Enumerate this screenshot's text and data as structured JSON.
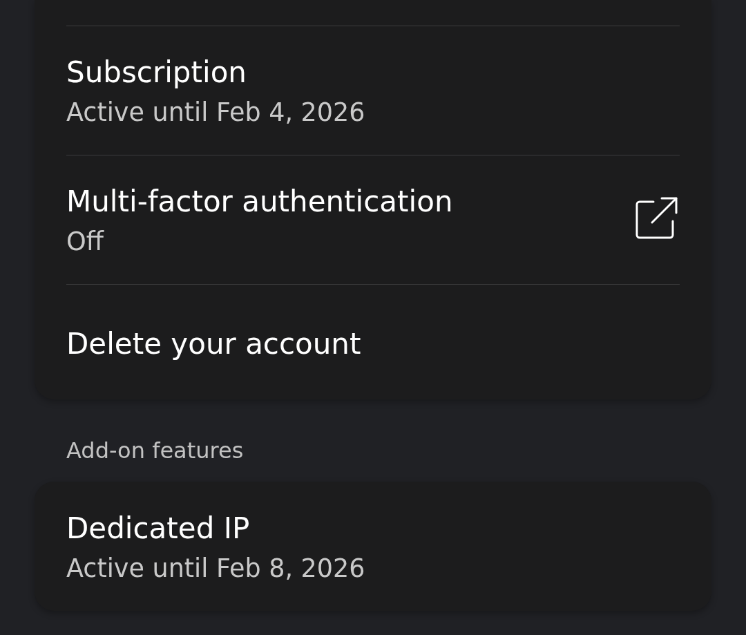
{
  "account_card": {
    "items": [
      {
        "kind": "status",
        "title": "Subscription",
        "subtitle": "Active until Feb 4, 2026"
      },
      {
        "kind": "external_link",
        "title": "Multi-factor authentication",
        "subtitle": "Off"
      },
      {
        "kind": "action",
        "title": "Delete your account"
      }
    ]
  },
  "addons_section": {
    "heading": "Add-on features",
    "items": [
      {
        "kind": "status",
        "title": "Dedicated IP",
        "subtitle": "Active until Feb 8, 2026"
      }
    ]
  }
}
